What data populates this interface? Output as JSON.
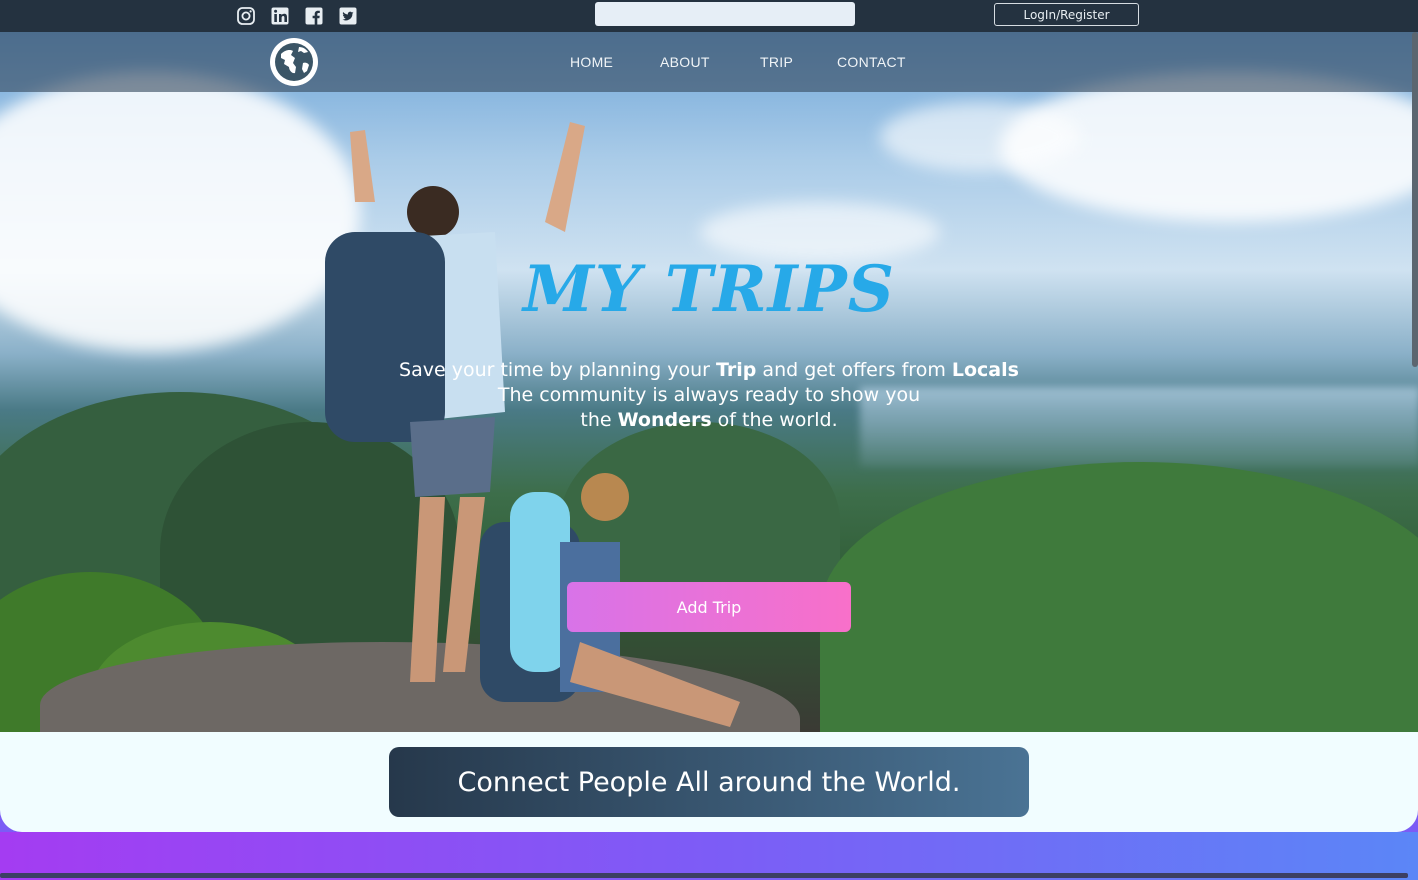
{
  "topbar": {
    "social_icons": [
      "instagram-icon",
      "linkedin-icon",
      "facebook-icon",
      "twitter-icon"
    ],
    "search": {
      "value": "",
      "placeholder": ""
    },
    "login_label": "LogIn/Register"
  },
  "nav": {
    "logo_icon": "globe-icon",
    "items": [
      {
        "label": "HOME"
      },
      {
        "label": "ABOUT"
      },
      {
        "label": "TRIP"
      },
      {
        "label": "CONTACT"
      }
    ]
  },
  "hero": {
    "title": "MY TRIPS",
    "tagline": {
      "line1_a": "Save your time by planning your ",
      "line1_trip": "Trip",
      "line1_b": " and get offers from ",
      "line1_locals": "Locals",
      "line2": "The community is always ready to show you",
      "line3_a": "the ",
      "line3_wonders": "Wonders",
      "line3_b": " of the world."
    },
    "add_trip_label": "Add Trip"
  },
  "band": {
    "connect_text": "Connect People All around the World."
  },
  "colors": {
    "topbar": "#243240",
    "title": "#27a9e8",
    "button_start": "#d873e8",
    "button_end": "#f870c9",
    "connect_start": "#26384b",
    "connect_end": "#4a7394"
  }
}
